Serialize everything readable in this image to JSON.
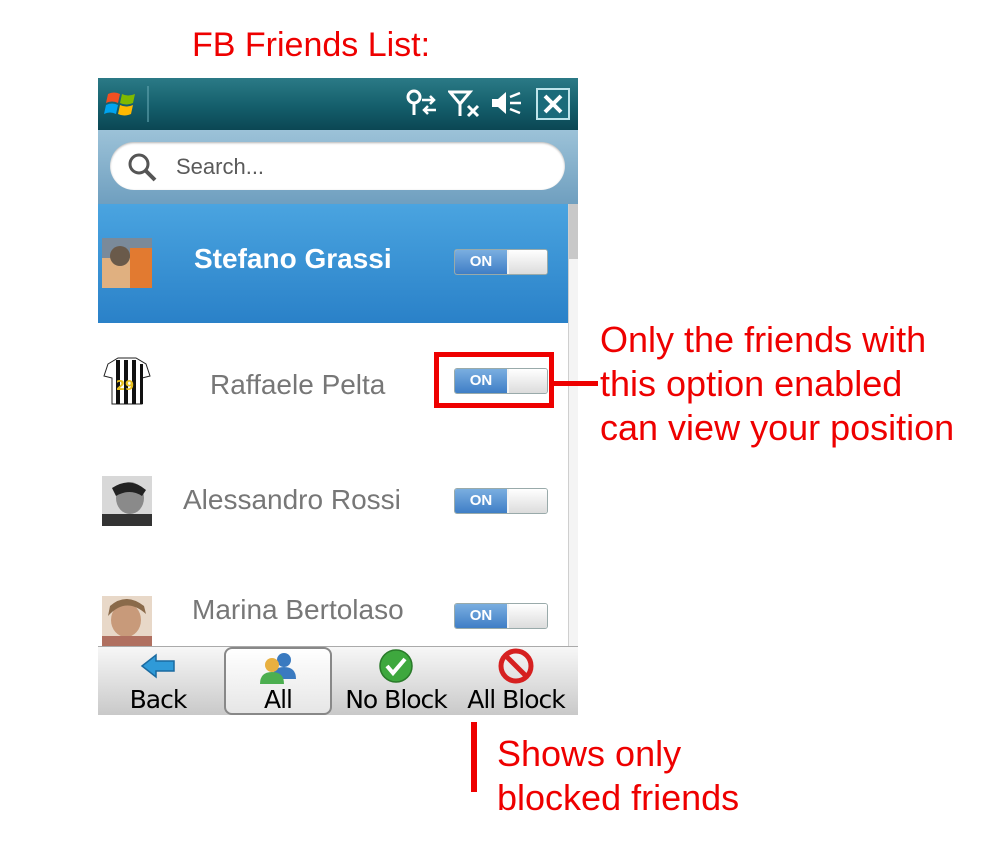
{
  "heading": "FB Friends List:",
  "search": {
    "placeholder": "Search..."
  },
  "friends": [
    {
      "name": "Stefano Grassi",
      "toggle": "ON",
      "selected": true
    },
    {
      "name": "Raffaele Pelta",
      "toggle": "ON",
      "selected": false
    },
    {
      "name": "Alessandro Rossi",
      "toggle": "ON",
      "selected": false
    },
    {
      "name": "Marina Bertolaso",
      "toggle": "ON",
      "selected": false
    }
  ],
  "toolbar": {
    "back": "Back",
    "all": "All",
    "no_block": "No Block",
    "all_block": "All Block"
  },
  "annotations": {
    "toggle_note": [
      "Only the friends with",
      "this option enabled",
      "can view your position"
    ],
    "allblock_note": [
      "Shows only",
      "blocked friends"
    ]
  },
  "colors": {
    "accent_red": "#ee0000",
    "selected_row": "#2a81c8",
    "toggle_on": "#3f7ec6"
  },
  "icons": [
    "windows-logo-icon",
    "connectivity-icon",
    "no-signal-icon",
    "speaker-mute-icon",
    "close-icon",
    "search-icon",
    "back-arrow-icon",
    "contacts-icon",
    "checkmark-icon",
    "no-entry-icon"
  ]
}
